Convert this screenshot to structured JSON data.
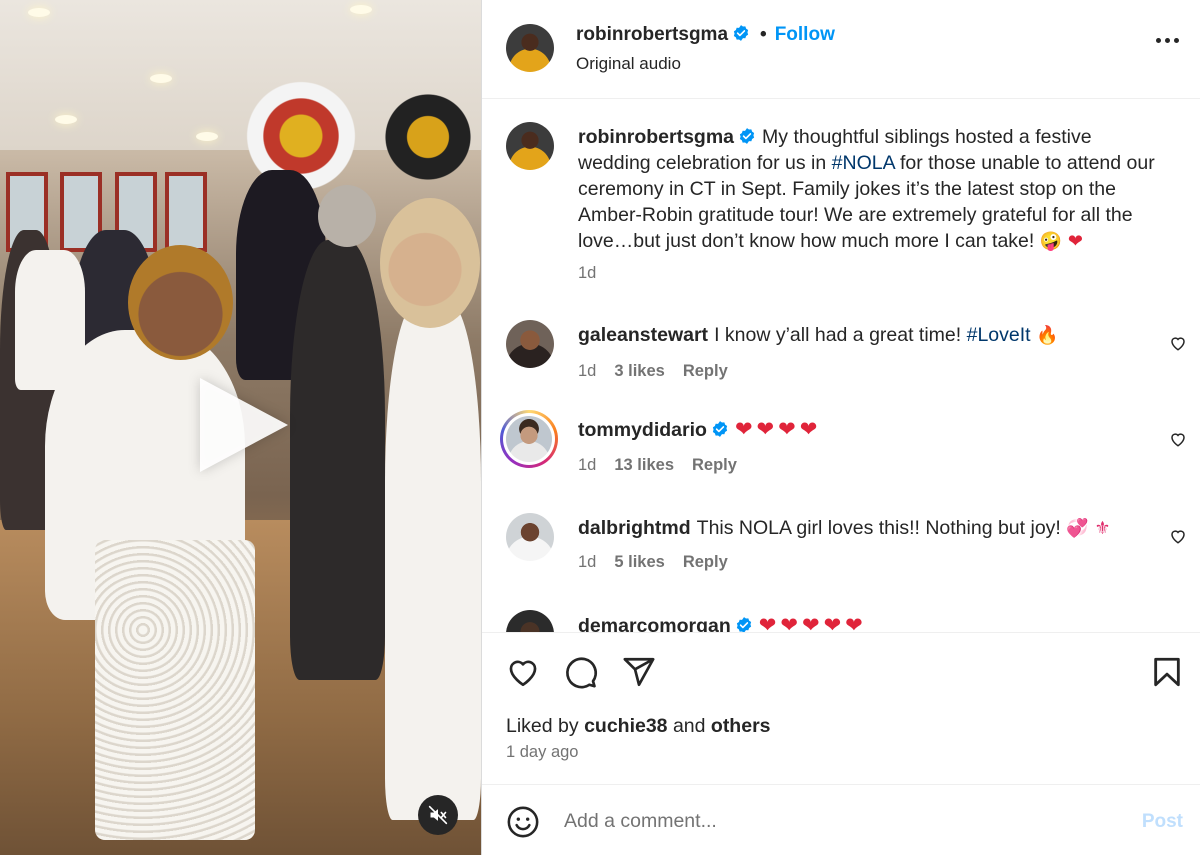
{
  "post": {
    "author": "robinrobertsgma",
    "verified": true,
    "follow_label": "Follow",
    "separator": "•",
    "audio": "Original audio",
    "caption": {
      "username": "robinrobertsgma",
      "text_before": "My thoughtful siblings hosted a festive wedding celebration for us in ",
      "hashtag": "#NOLA",
      "text_after": " for those unable to attend our ceremony in CT in Sept. Family jokes it’s the latest stop on the Amber-Robin gratitude tour! We are extremely grateful for all the love…but just don’t know how much more I can take!",
      "emojis": "🤪 ❤",
      "time": "1d"
    },
    "comments": [
      {
        "username": "galeanstewart",
        "verified": false,
        "text": "I know y’all had a great time! ",
        "hashtag": "#LoveIt",
        "emoji": "🔥",
        "time": "1d",
        "likes": "3 likes",
        "reply": "Reply"
      },
      {
        "username": "tommydidario",
        "verified": true,
        "text": "",
        "hearts": "❤❤❤❤",
        "time": "1d",
        "likes": "13 likes",
        "reply": "Reply"
      },
      {
        "username": "dalbrightmd",
        "verified": false,
        "text": "This NOLA girl loves this!! Nothing but joy! ",
        "emoji": "💞 ⚜",
        "time": "1d",
        "likes": "5 likes",
        "reply": "Reply"
      },
      {
        "username": "demarcomorgan",
        "verified": true,
        "hearts": "❤❤❤❤❤"
      }
    ],
    "liked_by": {
      "prefix": "Liked by ",
      "user": "cuchie38",
      "middle": " and ",
      "others": "others"
    },
    "time_ago": "1 day ago",
    "add_comment_placeholder": "Add a comment...",
    "post_label": "Post"
  },
  "colors": {
    "accent": "#0095f6",
    "hashtag": "#00376b",
    "heart": "#e0243a",
    "post_disabled": "#c0dffd"
  },
  "icons": {
    "video": [
      "play-icon",
      "muted-speaker-icon"
    ],
    "header": [
      "verified-badge-icon",
      "more-options-icon"
    ],
    "actions": [
      "heart-icon",
      "comment-icon",
      "share-icon",
      "bookmark-icon",
      "emoji-icon"
    ]
  }
}
